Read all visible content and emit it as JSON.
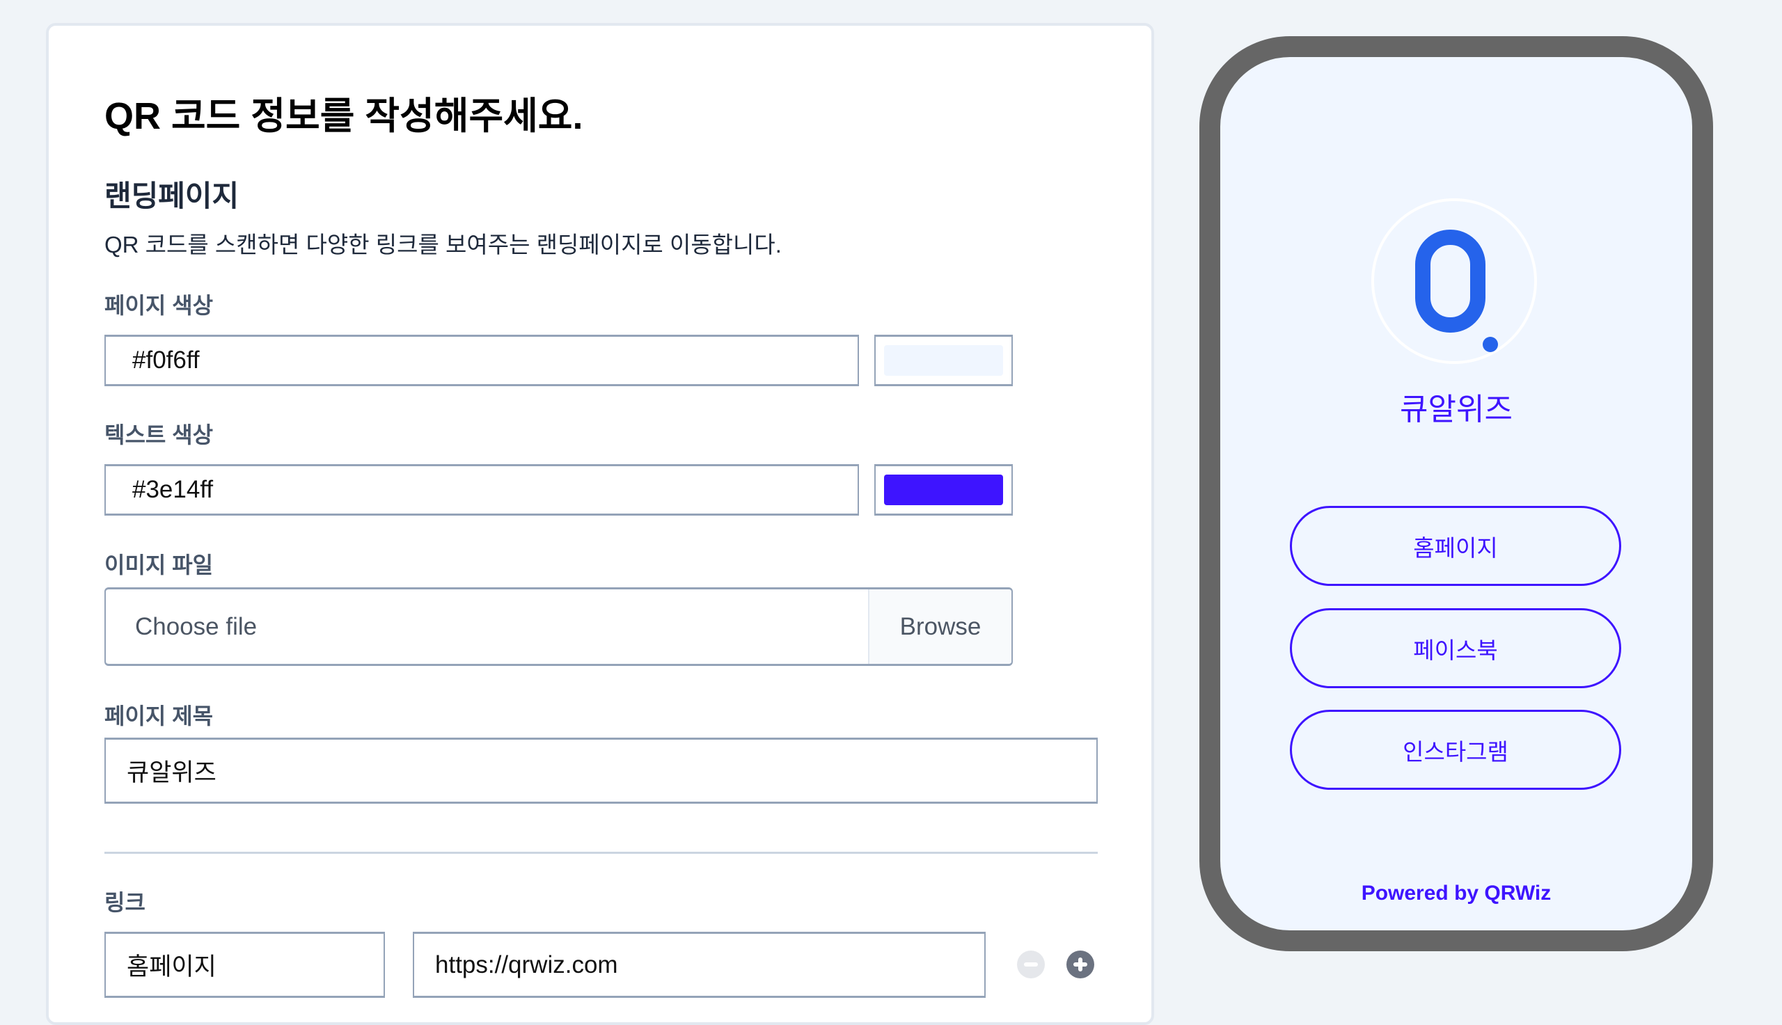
{
  "form": {
    "title": "QR 코드 정보를 작성해주세요.",
    "section_title": "랜딩페이지",
    "description": "QR 코드를 스캔하면 다양한 링크를 보여주는 랜딩페이지로 이동합니다.",
    "page_color": {
      "label": "페이지 색상",
      "value": "#f0f6ff"
    },
    "text_color": {
      "label": "텍스트 색상",
      "value": "#3e14ff"
    },
    "image_file": {
      "label": "이미지 파일",
      "placeholder": "Choose file",
      "browse_label": "Browse"
    },
    "page_title": {
      "label": "페이지 제목",
      "value": "큐알위즈"
    },
    "links": {
      "label": "링크",
      "rows": [
        {
          "name": "홈페이지",
          "url": "https://qrwiz.com"
        }
      ],
      "remove_icon": "minus-circle-icon",
      "add_icon": "plus-circle-icon"
    }
  },
  "preview": {
    "background_color": "#f0f6ff",
    "text_color": "#3e14ff",
    "logo_color": "#2563eb",
    "logo_icon": "qrwiz-logo",
    "title": "큐알위즈",
    "buttons": [
      {
        "label": "홈페이지"
      },
      {
        "label": "페이스북"
      },
      {
        "label": "인스타그램"
      }
    ],
    "footer": "Powered by QRWiz"
  }
}
